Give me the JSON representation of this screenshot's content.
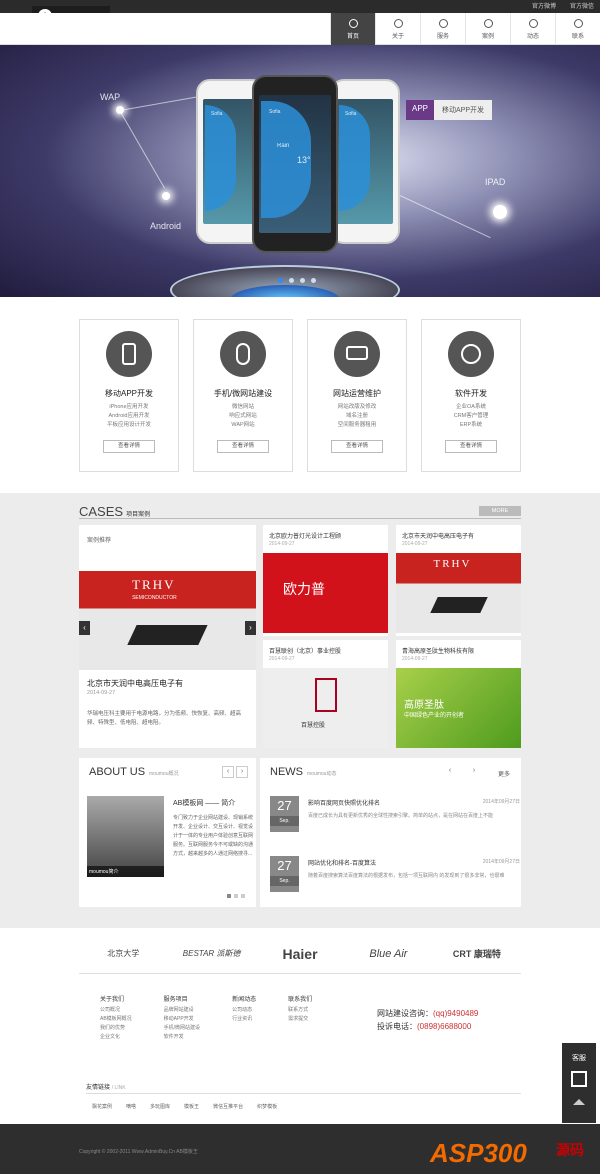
{
  "topbar": {
    "links": [
      "官方微博",
      "官方微信"
    ]
  },
  "nav": {
    "items": [
      {
        "label": "首页",
        "active": true
      },
      {
        "label": "关于"
      },
      {
        "label": "服务"
      },
      {
        "label": "案例"
      },
      {
        "label": "动态"
      },
      {
        "label": "联系"
      }
    ]
  },
  "banner": {
    "labels": {
      "wap": "WAP",
      "android": "Android",
      "ipad": "IPAD"
    },
    "app_badge": "APP",
    "app_text": "移动APP开发",
    "phone_left": {
      "city": "Sofia",
      "rows": [
        "Rainfall",
        "Wind",
        "Humidity",
        "AP"
      ]
    },
    "phone_center": {
      "city": "Sofia",
      "rain": "Rain",
      "temp": "13°"
    },
    "phone_right": {
      "city": "Sofia",
      "rows": [
        "Rainfall",
        "Wind",
        "Humidity",
        "AP"
      ]
    }
  },
  "services": [
    {
      "title": "移动APP开发",
      "lines": [
        "iPhone应用开发",
        "Android应用开发",
        "平板应用设计开发"
      ],
      "button": "查看详情"
    },
    {
      "title": "手机/微网站建设",
      "lines": [
        "微信网站",
        "响应式网站",
        "WAP网站"
      ],
      "button": "查看详情"
    },
    {
      "title": "网站运营维护",
      "lines": [
        "网站改版及修改",
        "域名注册",
        "空间服务器租用"
      ],
      "button": "查看详情"
    },
    {
      "title": "软件开发",
      "lines": [
        "企业OA系统",
        "CRM客户管理",
        "ERP系统"
      ],
      "button": "查看详情"
    }
  ],
  "cases": {
    "title": "CASES",
    "subtitle": "项目案例",
    "more": "MORE",
    "featured": {
      "tag": "案例推荐",
      "title": "北京市天润中电高压电子有",
      "date": "2014-09-27",
      "desc": "华瑞电压科主要用于电源电路，分为低频、快恢复、高频、超高频、特殊型、低电阻、超电阻。",
      "brand": "TRHV",
      "brand_sub": "SEMICONDUCTOR"
    },
    "cards": [
      {
        "title": "北京欧力普灯光设计工程顾",
        "date": "2014-09-27",
        "logo": "欧力普"
      },
      {
        "title": "北京市天润中电高压电子有",
        "date": "2014-09-27",
        "logo": "TRHV"
      },
      {
        "title": "百慧联创（北京）事业控股",
        "date": "2014-09-27",
        "logo": "百慧控股"
      },
      {
        "title": "青海高原圣肽生物科技有限",
        "date": "2014-09-27",
        "logo": "高原圣肽",
        "logo_sub": "中国绿色产业的开创者"
      }
    ]
  },
  "about": {
    "title": "ABOUT US",
    "subtitle": "moumou概况",
    "heading": "AB模板网 —— 简介",
    "caption": "moumou简介",
    "text": "专门致力于企业网站建设、现销系统开发、企业设计、交互设计、视觉设计于一体的专业用户体验创意互联网服务。互联网服务今不可或缺的沟通方式，越来越多的人通过网络搜寻..."
  },
  "news": {
    "title": "NEWS",
    "subtitle": "moumou动态",
    "more": "更多",
    "items": [
      {
        "day": "27",
        "month": "Sep.",
        "title": "影响百度网页快照优化排名",
        "date": "2014年09月27日",
        "text": "百度已成长为具有更新优秀的全球性搜索引擎。简单的站点，是在网站在百度上不能"
      },
      {
        "day": "27",
        "month": "Sep.",
        "title": "网站优化和排名-百度算法",
        "date": "2014年09月27日",
        "text": "随着百度搜索算法百度算法的根据发布，包括一项互联网内 的发现到了很多非常，也很难"
      }
    ]
  },
  "brands": [
    "北京大学",
    "BESTAR 派斯德",
    "Haier",
    "Blue Air",
    "CRT 康瑞特"
  ],
  "footer": {
    "cols": [
      {
        "title": "关于我们",
        "items": [
          "公司概况",
          "AB模板网概况",
          "我们的优势",
          "企业文化"
        ]
      },
      {
        "title": "服务项目",
        "items": [
          "品牌网站建设",
          "移动APP开发",
          "手机/微网站建设",
          "软件开发"
        ]
      },
      {
        "title": "新闻动态",
        "items": [
          "公司动态",
          "行业资讯"
        ]
      },
      {
        "title": "联系我们",
        "items": [
          "联系方式",
          "需求提交"
        ]
      }
    ],
    "consult_label": "网站建设咨询：",
    "consult_value": "(qq)9490489",
    "complain_label": "投诉电话：",
    "complain_value": "(0898)6688000",
    "friend_label": "友情链接",
    "friend_sub": "/ LINK",
    "friend_links": [
      "飘花案例",
      "嘀嗒",
      "多玩图库",
      "模板王",
      "微信互推平台",
      "织梦模板"
    ],
    "copyright": "Copyright © 2002-2011 Www.AdminBuy.Cn AB模板王"
  },
  "side": {
    "service": "客服"
  },
  "watermark": {
    "main": "ASP300",
    "sub": "源码"
  }
}
